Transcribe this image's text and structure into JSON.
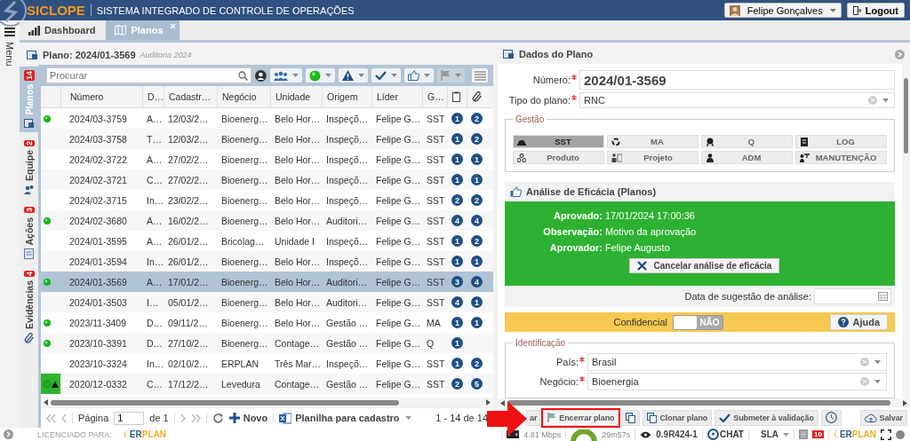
{
  "header": {
    "logo": "SICLOPE",
    "subtitle": "SISTEMA INTEGRADO DE CONTROLE DE OPERAÇÕES",
    "user": "Felipe Gonçalves",
    "logout": "Logout"
  },
  "menu": {
    "label": "Menu"
  },
  "tabs": [
    {
      "label": "Dashboard",
      "selected": false
    },
    {
      "label": "Planos",
      "selected": true
    }
  ],
  "plan_panel": {
    "title": "Plano: 2024/01-3569",
    "subtitle": "Auditoria 2024"
  },
  "side_tabs": [
    {
      "label": "Planos",
      "count": "14",
      "selected": true
    },
    {
      "label": "Equipe",
      "count": "2",
      "selected": false
    },
    {
      "label": "Ações",
      "count": "3",
      "selected": false
    },
    {
      "label": "Evidências",
      "count": "4",
      "selected": false
    }
  ],
  "grid": {
    "search": {
      "placeholder": "Procurar"
    },
    "columns": [
      "Número",
      "D…",
      "Cadastr…",
      "Negócio",
      "Unidade",
      "Origem",
      "Líder",
      "G…"
    ],
    "rows": [
      {
        "active": true,
        "warning": false,
        "selected": false,
        "cells": [
          "2024/03-3759",
          "A…",
          "12/03/2…",
          "Bioenerg…",
          "Belo Hor…",
          "Inspeçõ…",
          "Felipe G…",
          "SST"
        ],
        "count_1": "1",
        "count_2": "2"
      },
      {
        "active": false,
        "warning": false,
        "selected": false,
        "cells": [
          "2024/03-3758",
          "T…",
          "12/03/2…",
          "Bioenerg…",
          "Belo Hor…",
          "Inspeçõ…",
          "Felipe G…",
          "SST"
        ],
        "count_1": "1",
        "count_2": "2"
      },
      {
        "active": false,
        "warning": false,
        "selected": false,
        "cells": [
          "2024/02-3722",
          "A…",
          "27/02/2…",
          "Bioenerg…",
          "Belo Hor…",
          "Inspeçõ…",
          "Felipe G…",
          "SST"
        ],
        "count_1": "1",
        "count_2": "1"
      },
      {
        "active": false,
        "warning": false,
        "selected": false,
        "cells": [
          "2024/02-3721",
          "C…",
          "27/02/2…",
          "Bioenerg…",
          "Belo Hor…",
          "Inspeçõ…",
          "Felipe G…",
          "SST"
        ],
        "count_1": "1",
        "count_2": "1"
      },
      {
        "active": false,
        "warning": false,
        "selected": false,
        "cells": [
          "2024/02-3715",
          "In…",
          "23/02/2…",
          "Bioenerg…",
          "Belo Hor…",
          "Inspeçõ…",
          "Felipe G…",
          "SST"
        ],
        "count_1": "2",
        "count_2": "2"
      },
      {
        "active": true,
        "warning": false,
        "selected": false,
        "cells": [
          "2024/02-3680",
          "A…",
          "16/02/2…",
          "Bioenerg…",
          "Belo Hor…",
          "Auditori…",
          "Felipe G…",
          "SST"
        ],
        "count_1": "4",
        "count_2": "4"
      },
      {
        "active": false,
        "warning": false,
        "selected": false,
        "cells": [
          "2024/01-3595",
          "A…",
          "26/01/2…",
          "Bricolag…",
          "Unidade I",
          "Inspeçõ…",
          "Felipe G…",
          "SST"
        ],
        "count_1": "1",
        "count_2": "2"
      },
      {
        "active": false,
        "warning": false,
        "selected": false,
        "cells": [
          "2024/01-3594",
          "In…",
          "26/01/2…",
          "Bioenerg…",
          "Belo Hor…",
          "Inspeçõ…",
          "Felipe G…",
          "SST"
        ],
        "count_1": "1",
        "count_2": "1"
      },
      {
        "active": true,
        "warning": false,
        "selected": true,
        "cells": [
          "2024/01-3569",
          "A…",
          "17/01/2…",
          "Bioenerg…",
          "Belo Hor…",
          "Auditori…",
          "Felipe G…",
          "SST"
        ],
        "count_1": "3",
        "count_2": "4"
      },
      {
        "active": false,
        "warning": false,
        "selected": false,
        "cells": [
          "2024/01-3503",
          "I…",
          "05/01/2…",
          "Bioenerg…",
          "Belo Hor…",
          "Auditori…",
          "Felipe G…",
          "SST"
        ],
        "count_1": "4",
        "count_2": "1"
      },
      {
        "active": true,
        "warning": false,
        "selected": false,
        "cells": [
          "2023/11-3409",
          "D…",
          "09/11/2…",
          "Bioenerg…",
          "Belo Hor…",
          "Gestão …",
          "Felipe G…",
          "MA"
        ],
        "count_1": "1",
        "count_2": "1"
      },
      {
        "active": true,
        "warning": false,
        "selected": false,
        "cells": [
          "2023/10-3391",
          "D…",
          "27/10/2…",
          "Bioenerg…",
          "Contage…",
          "Gestão …",
          "Felipe G…",
          "Q"
        ],
        "count_1": "1"
      },
      {
        "active": false,
        "warning": false,
        "selected": false,
        "cells": [
          "2023/10-3324",
          "In…",
          "02/10/2…",
          "ERPLAN",
          "Três Mar…",
          "Inspeçõ…",
          "Felipe G…",
          "SST"
        ],
        "count_1": "1",
        "count_2": "2"
      },
      {
        "active": true,
        "warning": true,
        "selected": false,
        "cells": [
          "2020/12-0332",
          "C…",
          "17/12/2…",
          "Levedura",
          "Contage…",
          "Gestão …",
          "Felipe G…",
          "SST"
        ],
        "count_1": "2",
        "count_2": "5"
      }
    ]
  },
  "pager": {
    "page_label": "Página",
    "page": "1",
    "of": "de 1",
    "new": "Novo",
    "export": "Planilha para cadastro",
    "range": "1 - 14 de 14"
  },
  "details": {
    "title": "Dados do Plano",
    "number": {
      "label": "Número:",
      "value": "2024/01-3569",
      "required": true
    },
    "plan_type": {
      "label": "Tipo do plano:",
      "value": "RNC",
      "required": true
    },
    "gestao": {
      "legend": "Gestão",
      "options": [
        {
          "label": "SST",
          "selected": true
        },
        {
          "label": "MA",
          "selected": false
        },
        {
          "label": "Q",
          "selected": false
        },
        {
          "label": "LOG",
          "selected": false
        },
        {
          "label": "Produto",
          "selected": false
        },
        {
          "label": "Projeto",
          "selected": false
        },
        {
          "label": "ADM",
          "selected": false
        },
        {
          "label": "MANUTENÇÃO",
          "selected": false
        }
      ]
    },
    "efficacy": {
      "title": "Análise de Eficácia (Planos)",
      "approved": true,
      "fields": [
        {
          "label": "Aprovado:",
          "value": "17/01/2024 17:00:36"
        },
        {
          "label": "Observação:",
          "value": "Motivo da aprovação"
        },
        {
          "label": "Aprovador:",
          "value": "Felipe Augusto"
        }
      ],
      "cancel": "Cancelar análise de eficácia",
      "date_label": "Data de sugestão de análise:"
    },
    "confidential": {
      "label": "Confidencial",
      "on": false,
      "state_text": "NÃO",
      "help": "Ajuda"
    },
    "identification": {
      "legend": "Identificação",
      "fields": [
        {
          "label": "País:",
          "value": "Brasil",
          "required": true
        },
        {
          "label": "Negócio:",
          "value": "Bioenergia",
          "required": true
        }
      ]
    }
  },
  "actions": [
    {
      "kind": "text",
      "label": "ar",
      "highlighted": false
    },
    {
      "kind": "text",
      "label": "Encerrar plano",
      "highlighted": true
    },
    {
      "kind": "icon"
    },
    {
      "kind": "text",
      "label": "Clonar plano",
      "highlighted": false
    },
    {
      "kind": "text",
      "label": "Submeter à validação",
      "highlighted": false
    },
    {
      "kind": "icon"
    },
    {
      "kind": "save",
      "label": "Salvar",
      "highlighted": false
    }
  ],
  "status_bar": {
    "license_label": "LICENCIADO PARA:",
    "license_logo": "ERPLAN",
    "speed": "4.81 Mbps",
    "session": "29m57s",
    "version": "0.9R424-1",
    "chat": "CHAT",
    "sla": "SLA",
    "notifications": "10",
    "brand": "ERPLAN"
  }
}
